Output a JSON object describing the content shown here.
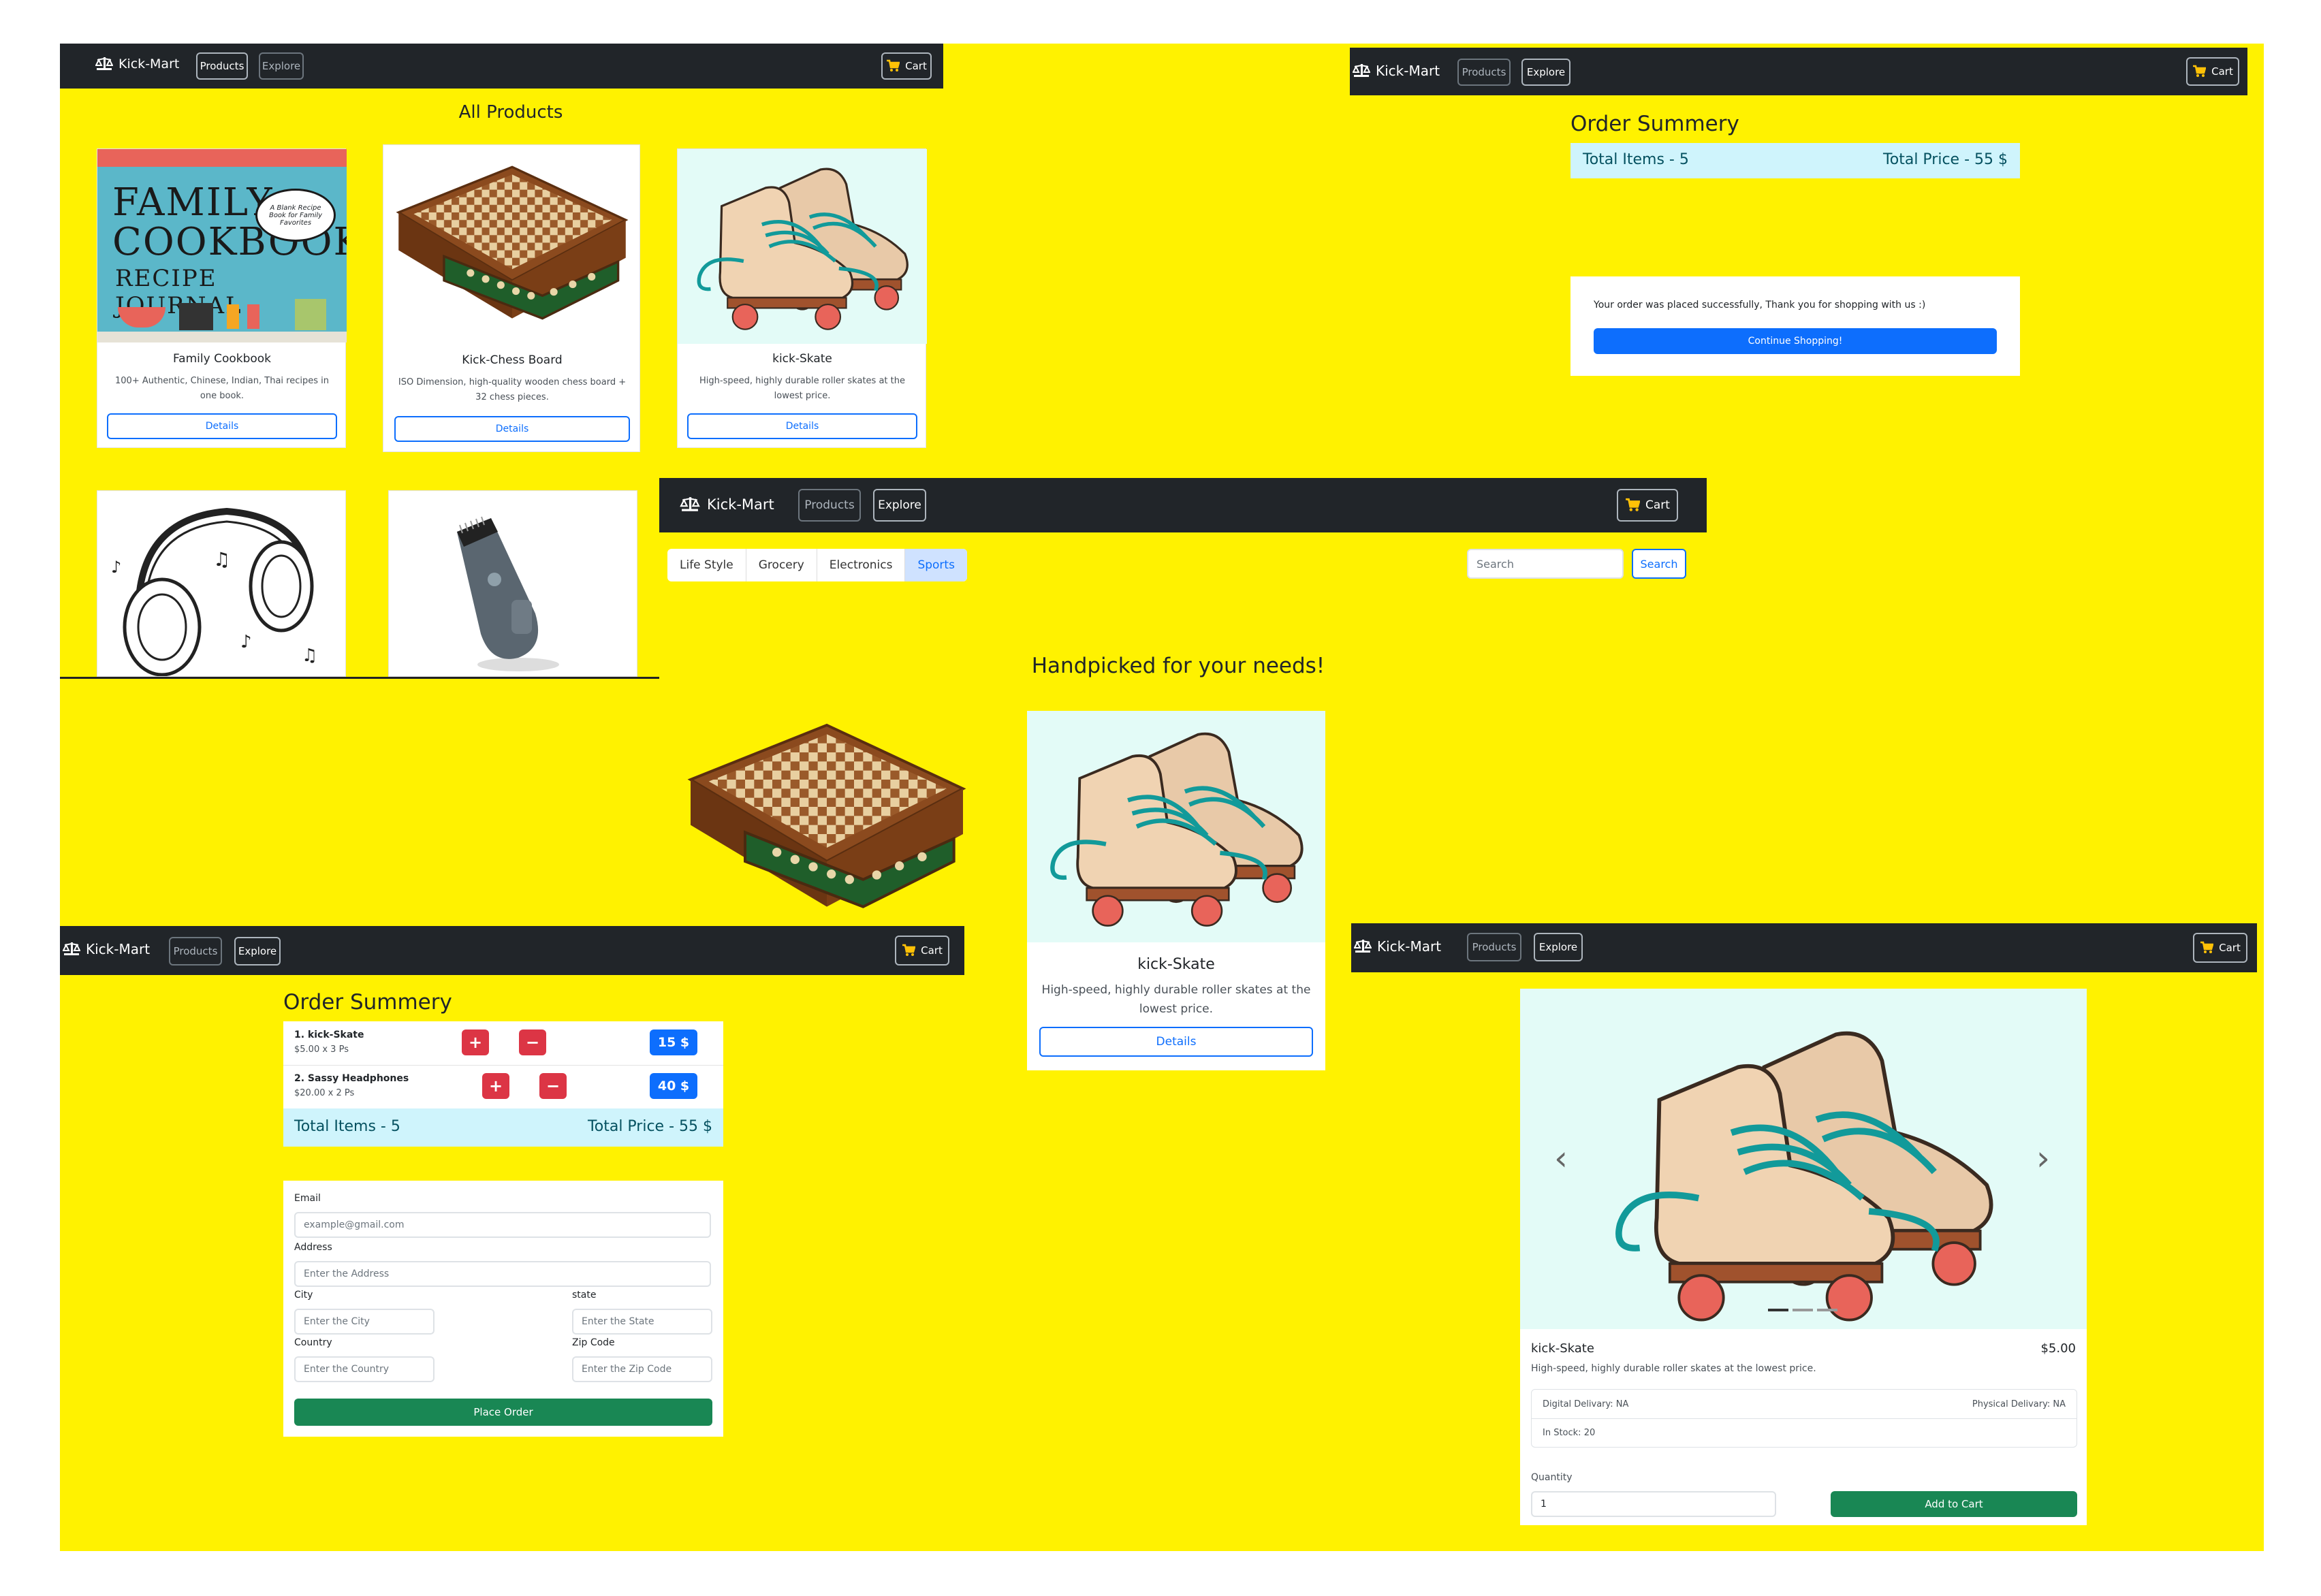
{
  "brand": "Kick-Mart",
  "nav": {
    "products": "Products",
    "explore": "Explore",
    "cart": "Cart"
  },
  "colors": {
    "background": "#fff200",
    "navbar": "#212529",
    "primary": "#0d6efd",
    "danger": "#dc3545",
    "success": "#198754",
    "info": "#cff4fc"
  },
  "all_products": {
    "title": "All Products",
    "cards": [
      {
        "name": "Family Cookbook",
        "desc": "100+ Authentic, Chinese, Indian, Thai recipes in one book.",
        "button": "Details",
        "image_icon": "cookbook-cover"
      },
      {
        "name": "Kick-Chess Board",
        "desc": "ISO Dimension, high-quality wooden chess board + 32 chess pieces.",
        "button": "Details",
        "image_icon": "chess-board"
      },
      {
        "name": "kick-Skate",
        "desc": "High-speed, highly durable roller skates at the lowest price.",
        "button": "Details",
        "image_icon": "roller-skates"
      }
    ],
    "cookbook_cover": {
      "line1": "FAMILY",
      "line2": "COOKBOOK",
      "line3": "RECIPE JOURNAL",
      "badge": "A Blank Recipe Book for Family Favorites"
    }
  },
  "order_summary_top": {
    "title": "Order Summery",
    "total_items": "Total Items - 5",
    "total_price": "Total Price - 55 $",
    "success_message": "Your order was placed successfully, Thank you for shopping with us :)",
    "continue_button": "Continue Shopping!"
  },
  "explore": {
    "categories": [
      "Life Style",
      "Grocery",
      "Electronics",
      "Sports"
    ],
    "active_category": "Sports",
    "search_placeholder": "Search",
    "search_button": "Search",
    "heading": "Handpicked for your needs!",
    "card": {
      "name": "kick-Skate",
      "desc": "High-speed, highly durable roller skates at the lowest price.",
      "button": "Details"
    }
  },
  "checkout": {
    "title": "Order Summery",
    "items": [
      {
        "name": "1. kick-Skate",
        "detail": "$5.00 x 3 Ps",
        "total": "15 $"
      },
      {
        "name": "2. Sassy Headphones",
        "detail": "$20.00 x 2 Ps",
        "total": "40 $"
      }
    ],
    "plus": "+",
    "minus": "−",
    "total_items": "Total Items - 5",
    "total_price": "Total Price - 55 $",
    "form": {
      "email_label": "Email",
      "email_placeholder": "example@gmail.com",
      "address_label": "Address",
      "address_placeholder": "Enter the Address",
      "city_label": "City",
      "city_placeholder": "Enter the City",
      "state_label": "state",
      "state_placeholder": "Enter the State",
      "country_label": "Country",
      "country_placeholder": "Enter the Country",
      "zip_label": "Zip Code",
      "zip_placeholder": "Enter the Zip Code",
      "submit": "Place Order"
    }
  },
  "product_detail": {
    "name": "kick-Skate",
    "price": "$5.00",
    "desc": "High-speed, highly durable roller skates at the lowest price.",
    "digital": "Digital Delivary: NA",
    "physical": "Physical Delivary: NA",
    "stock": "In Stock: 20",
    "quantity_label": "Quantity",
    "quantity_value": "1",
    "add_button": "Add to Cart",
    "carousel_prev": "‹",
    "carousel_next": "›"
  }
}
